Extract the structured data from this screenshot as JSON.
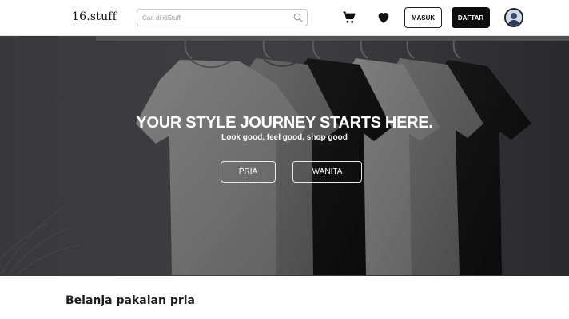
{
  "header": {
    "logo": "16.stuff",
    "search": {
      "placeholder": "Cari di i6Stuff",
      "value": ""
    },
    "icons": [
      "cart-icon",
      "heart-icon"
    ],
    "login_label": "MASUK",
    "register_label": "DAFTAR"
  },
  "hero": {
    "title": "YOUR STYLE JOURNEY STARTS HERE.",
    "subtitle": "Look good, feel good, shop good",
    "buttons": {
      "men_label": "PRIA",
      "women_label": "WANITA"
    }
  },
  "section": {
    "title": "Belanja pakaian pria"
  },
  "colors": {
    "primary": "#0d0d0d",
    "hero_overlay": "#4b4b50",
    "white": "#ffffff",
    "border": "#c9c9c9"
  }
}
